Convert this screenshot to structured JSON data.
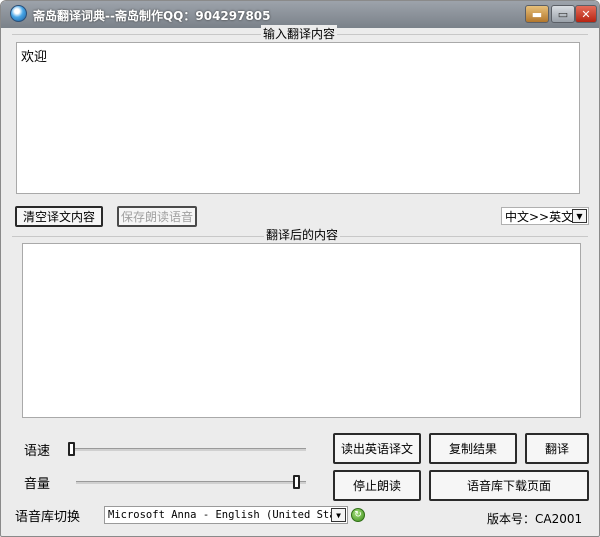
{
  "window": {
    "title": "斋岛翻译词典--斋岛制作QQ：904297805",
    "skin_glyph": "▬",
    "maximize_glyph": "▭",
    "close_glyph": "✕"
  },
  "input_section": {
    "label": "输入翻译内容",
    "value": "欢迎"
  },
  "toolbar": {
    "clear_label": "清空译文内容",
    "save_audio_label": "保存朗读语音",
    "direction_value": "中文>>英文",
    "dropdown_glyph": "▼"
  },
  "output_section": {
    "label": "翻译后的内容",
    "value": ""
  },
  "controls": {
    "speed_label": "语速",
    "speed_level": 0,
    "volume_label": "音量",
    "volume_level": 1,
    "voice_label": "语音库切换",
    "voice_value": "Microsoft Anna - English (United States)",
    "refresh_glyph": "↻"
  },
  "buttons": {
    "read_english": "读出英语译文",
    "copy_result": "复制结果",
    "translate": "翻译",
    "stop_reading": "停止朗读",
    "voice_download_page": "语音库下载页面"
  },
  "footer": {
    "version_text": "版本号：CA2001"
  }
}
